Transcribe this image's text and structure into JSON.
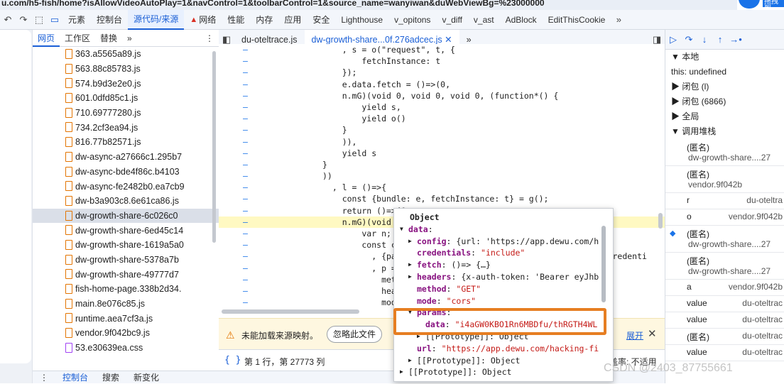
{
  "url_fragment": "u.com/h5-fish/home?isAllowVideoAutoPlay=1&navControl=1&toolbarControl=1&source_name=wanyiwan&duWebViewBg=%23000000",
  "badge_text": "拖拽到",
  "top_tabs": [
    "元素",
    "控制台",
    "源代码/来源",
    "网络",
    "性能",
    "内存",
    "应用",
    "安全",
    "Lighthouse",
    "v_opitons",
    "v_diff",
    "v_ast",
    "AdBlock",
    "EditThisCookie"
  ],
  "top_tab_active": "源代码/来源",
  "nav_tabs": [
    "网页",
    "工作区",
    "替换"
  ],
  "files": [
    {
      "name": "363.a5565a89.js",
      "type": "js"
    },
    {
      "name": "563.88c85783.js",
      "type": "js"
    },
    {
      "name": "574.b9d3e2e0.js",
      "type": "js"
    },
    {
      "name": "601.0dfd85c1.js",
      "type": "js"
    },
    {
      "name": "710.69777280.js",
      "type": "js"
    },
    {
      "name": "734.2cf3ea94.js",
      "type": "js"
    },
    {
      "name": "816.77b82571.js",
      "type": "js"
    },
    {
      "name": "dw-async-a27666c1.295b7",
      "type": "js"
    },
    {
      "name": "dw-async-bde4f86c.b4103",
      "type": "js"
    },
    {
      "name": "dw-async-fe2482b0.ea7cb9",
      "type": "js"
    },
    {
      "name": "dw-b3a903c8.6e61ca86.js",
      "type": "js"
    },
    {
      "name": "dw-growth-share-6c026c0",
      "type": "js",
      "selected": true
    },
    {
      "name": "dw-growth-share-6ed45c14",
      "type": "js"
    },
    {
      "name": "dw-growth-share-1619a5a0",
      "type": "js"
    },
    {
      "name": "dw-growth-share-5378a7b",
      "type": "js"
    },
    {
      "name": "dw-growth-share-49777d7",
      "type": "js"
    },
    {
      "name": "fish-home-page.338b2d34.",
      "type": "js"
    },
    {
      "name": "main.8e076c85.js",
      "type": "js"
    },
    {
      "name": "runtime.aea7cf3a.js",
      "type": "js"
    },
    {
      "name": "vendor.9f042bc9.js",
      "type": "js"
    },
    {
      "name": "53.e30639ea.css",
      "type": "css"
    }
  ],
  "editor_tabs": [
    "du-oteltrace.js",
    "dw-growth-share...0f.276adcec.js"
  ],
  "code_lines": [
    "    , s = o(\"request\", t, {",
    "        fetchInstance: t",
    "    });",
    "    e.data.fetch = ()=>(0,",
    "    n.mG)(void 0, void 0, void 0, (function*() {",
    "        yield s,",
    "        yield o()",
    "    }",
    "    )),",
    "    yield s",
    "}",
    "))",
    "  , l = ()=>{",
    "    const {bundle: e, fetchInstance: t} = g();",
    "    return ()=>(0,",
    "    n.mG)(void 0,",
    "        var n;",
    "        const c =",
    "          , {param                                        credenti",
    "          , p = {",
    "            method",
    "            header",
    "            mode:"
  ],
  "infobar": {
    "message": "未能加载来源映射。",
    "ignore_button": "忽略此文件",
    "expand": "展开"
  },
  "status": {
    "position": "第 1 行，第 27773 列",
    "coverage": "覆盖率: 不适用"
  },
  "drawer_tabs": [
    "控制台",
    "搜索",
    "新变化"
  ],
  "scope": [
    {
      "label": "▼ 本地"
    },
    {
      "label": "   this: undefined"
    },
    {
      "label": "▶ 闭包 (l)"
    },
    {
      "label": "▶ 闭包 (6866)"
    },
    {
      "label": "▶ 全局"
    },
    {
      "label": "▼ 调用堆栈"
    }
  ],
  "call_stack": [
    {
      "fn": "(匿名)",
      "loc": "dw-growth-share....27",
      "two": true
    },
    {
      "fn": "(匿名)",
      "loc": "vendor.9f042b",
      "two": true
    },
    {
      "fn": "r",
      "loc": "du-oteltra",
      "two": false
    },
    {
      "fn": "o",
      "loc": "vendor.9f042b",
      "two": false
    },
    {
      "fn": "(匿名)",
      "loc": "dw-growth-share....27",
      "two": true,
      "current": true
    },
    {
      "fn": "(匿名)",
      "loc": "dw-growth-share....27",
      "two": true
    },
    {
      "fn": "a",
      "loc": "vendor.9f042b",
      "two": false
    },
    {
      "fn": "value",
      "loc": "du-oteltrac",
      "two": false
    },
    {
      "fn": "value",
      "loc": "du-oteltrac",
      "two": false
    },
    {
      "fn": "(匿名)",
      "loc": "du-oteltrac",
      "two": false
    },
    {
      "fn": "value",
      "loc": "du-oteltrac",
      "two": false
    }
  ],
  "popover": {
    "title": "Object",
    "lines": [
      {
        "ind": 0,
        "tri": "▼",
        "k": "data",
        "v": ""
      },
      {
        "ind": 1,
        "tri": "▶",
        "k": "config",
        "v": "{url: 'https://app.dewu.com/h"
      },
      {
        "ind": 1,
        "tri": "",
        "k": "credentials",
        "v": "\"include\"",
        "str": true
      },
      {
        "ind": 1,
        "tri": "▶",
        "k": "fetch",
        "v": "()=> {…}"
      },
      {
        "ind": 1,
        "tri": "▶",
        "k": "headers",
        "v": "{x-auth-token: 'Bearer eyJhb"
      },
      {
        "ind": 1,
        "tri": "",
        "k": "method",
        "v": "\"GET\"",
        "str": true
      },
      {
        "ind": 1,
        "tri": "",
        "k": "mode",
        "v": "\"cors\"",
        "str": true
      },
      {
        "ind": 1,
        "tri": "▼",
        "k": "params",
        "v": ""
      },
      {
        "ind": 2,
        "tri": "",
        "k": "data",
        "v": "\"i4aGW0KBO1Rn6MBDfu/thRGTH4WL",
        "str": true
      },
      {
        "ind": 2,
        "tri": "▶",
        "k": "[[Prototype]]",
        "v": "Object",
        "plain": true
      },
      {
        "ind": 1,
        "tri": "",
        "k": "url",
        "v": "\"https://app.dewu.com/hacking-fi",
        "str": true
      },
      {
        "ind": 1,
        "tri": "▶",
        "k": "[[Prototype]]",
        "v": "Object",
        "plain": true
      },
      {
        "ind": 0,
        "tri": "▶",
        "k": "[[Prototype]]",
        "v": "Object",
        "plain": true
      }
    ]
  },
  "watermark": "CSDN @2403_87755661"
}
